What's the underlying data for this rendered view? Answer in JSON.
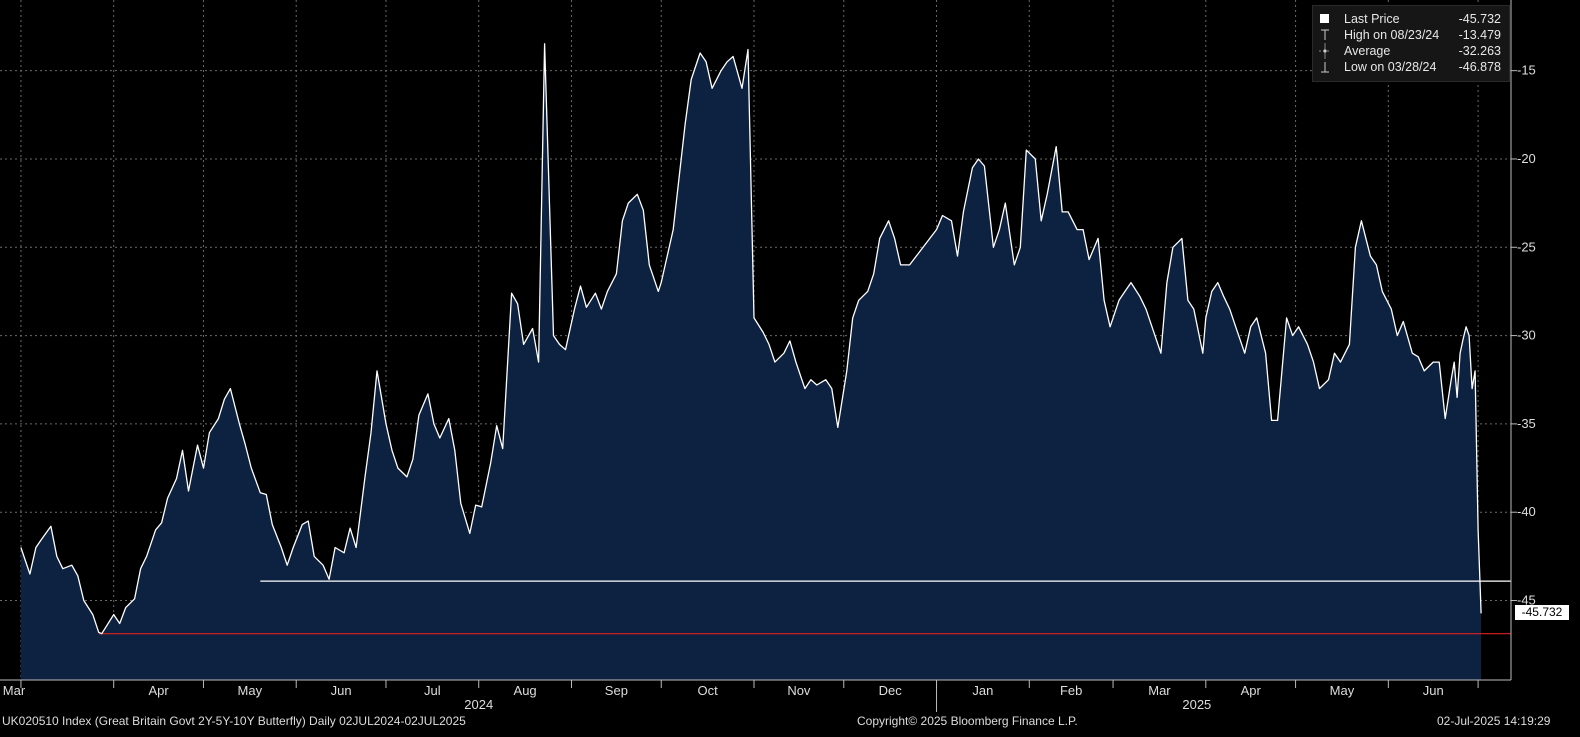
{
  "footer": {
    "left": "UK020510 Index (Great Britain Govt 2Y-5Y-10Y Butterfly)  Daily 02JUL2024-02JUL2025",
    "center": "Copyright© 2025 Bloomberg Finance L.P.",
    "right": "02-Jul-2025 14:19:29"
  },
  "legend": {
    "items": [
      {
        "icon": "square-filled-icon",
        "label": "Last Price",
        "value": "-45.732"
      },
      {
        "icon": "high-marker-icon",
        "label": "High on 08/23/24",
        "value": "-13.479"
      },
      {
        "icon": "average-line-icon",
        "label": "Average",
        "value": "-32.263"
      },
      {
        "icon": "low-marker-icon",
        "label": "Low on 03/28/24",
        "value": "-46.878"
      }
    ]
  },
  "last_value_tag": "-45.732",
  "colors": {
    "background": "#000000",
    "area_fill": "#0d2140",
    "line": "#ffffff",
    "low_line": "#e02020",
    "reference_line": "#ffffff",
    "grid": "#6a6a6a"
  },
  "chart_data": {
    "type": "area",
    "title": "",
    "xlabel": "",
    "ylabel": "",
    "ylim": [
      -49.5,
      -11
    ],
    "y_ticks": [
      -15,
      -20,
      -25,
      -30,
      -35,
      -40,
      -45
    ],
    "y_tick_labels": [
      "-15",
      "-20",
      "-25",
      "-30",
      "-35",
      "-40",
      "-45"
    ],
    "x_month_labels": [
      "Mar",
      "Apr",
      "May",
      "Jun",
      "Jul",
      "Aug",
      "Sep",
      "Oct",
      "Nov",
      "Dec",
      "Jan",
      "Feb",
      "Mar",
      "Apr",
      "May",
      "Jun"
    ],
    "x_year_labels": [
      "2024",
      "2025"
    ],
    "grid": true,
    "legend_position": "top-right",
    "reference_lines": [
      {
        "value": -43.9
      },
      {
        "value": -46.878
      }
    ],
    "series": [
      {
        "name": "Last Price",
        "points": [
          [
            "2024-03-01",
            -42.0
          ],
          [
            "2024-03-04",
            -43.5
          ],
          [
            "2024-03-06",
            -42.0
          ],
          [
            "2024-03-08",
            -41.5
          ],
          [
            "2024-03-11",
            -40.8
          ],
          [
            "2024-03-13",
            -42.5
          ],
          [
            "2024-03-15",
            -43.2
          ],
          [
            "2024-03-18",
            -43.0
          ],
          [
            "2024-03-20",
            -43.6
          ],
          [
            "2024-03-22",
            -45.0
          ],
          [
            "2024-03-25",
            -45.8
          ],
          [
            "2024-03-27",
            -46.8
          ],
          [
            "2024-03-28",
            -46.878
          ],
          [
            "2024-04-01",
            -45.8
          ],
          [
            "2024-04-03",
            -46.3
          ],
          [
            "2024-04-05",
            -45.4
          ],
          [
            "2024-04-08",
            -44.9
          ],
          [
            "2024-04-10",
            -43.2
          ],
          [
            "2024-04-12",
            -42.5
          ],
          [
            "2024-04-15",
            -41.0
          ],
          [
            "2024-04-17",
            -40.6
          ],
          [
            "2024-04-19",
            -39.2
          ],
          [
            "2024-04-22",
            -38.1
          ],
          [
            "2024-04-24",
            -36.5
          ],
          [
            "2024-04-26",
            -38.8
          ],
          [
            "2024-04-29",
            -36.2
          ],
          [
            "2024-05-01",
            -37.5
          ],
          [
            "2024-05-03",
            -35.5
          ],
          [
            "2024-05-06",
            -34.7
          ],
          [
            "2024-05-08",
            -33.6
          ],
          [
            "2024-05-10",
            -33.0
          ],
          [
            "2024-05-13",
            -35.0
          ],
          [
            "2024-05-15",
            -36.2
          ],
          [
            "2024-05-17",
            -37.5
          ],
          [
            "2024-05-20",
            -38.9
          ],
          [
            "2024-05-22",
            -39.0
          ],
          [
            "2024-05-24",
            -40.7
          ],
          [
            "2024-05-27",
            -42.0
          ],
          [
            "2024-05-29",
            -43.0
          ],
          [
            "2024-05-31",
            -42.0
          ],
          [
            "2024-06-03",
            -40.7
          ],
          [
            "2024-06-05",
            -40.5
          ],
          [
            "2024-06-07",
            -42.5
          ],
          [
            "2024-06-10",
            -43.0
          ],
          [
            "2024-06-12",
            -43.8
          ],
          [
            "2024-06-14",
            -42.0
          ],
          [
            "2024-06-17",
            -42.3
          ],
          [
            "2024-06-19",
            -40.9
          ],
          [
            "2024-06-21",
            -42.0
          ],
          [
            "2024-06-24",
            -38.0
          ],
          [
            "2024-06-26",
            -35.5
          ],
          [
            "2024-06-28",
            -32.0
          ],
          [
            "2024-07-01",
            -35.0
          ],
          [
            "2024-07-03",
            -36.5
          ],
          [
            "2024-07-05",
            -37.5
          ],
          [
            "2024-07-08",
            -38.0
          ],
          [
            "2024-07-10",
            -37.0
          ],
          [
            "2024-07-12",
            -34.5
          ],
          [
            "2024-07-15",
            -33.3
          ],
          [
            "2024-07-17",
            -35.0
          ],
          [
            "2024-07-19",
            -35.8
          ],
          [
            "2024-07-22",
            -34.7
          ],
          [
            "2024-07-24",
            -36.5
          ],
          [
            "2024-07-26",
            -39.5
          ],
          [
            "2024-07-29",
            -41.2
          ],
          [
            "2024-07-31",
            -39.6
          ],
          [
            "2024-08-02",
            -39.7
          ],
          [
            "2024-08-05",
            -37.2
          ],
          [
            "2024-08-07",
            -35.1
          ],
          [
            "2024-08-09",
            -36.4
          ],
          [
            "2024-08-12",
            -27.6
          ],
          [
            "2024-08-14",
            -28.2
          ],
          [
            "2024-08-16",
            -30.5
          ],
          [
            "2024-08-19",
            -29.6
          ],
          [
            "2024-08-21",
            -31.5
          ],
          [
            "2024-08-23",
            -13.479
          ],
          [
            "2024-08-26",
            -30.0
          ],
          [
            "2024-08-28",
            -30.5
          ],
          [
            "2024-08-30",
            -30.8
          ],
          [
            "2024-09-02",
            -28.5
          ],
          [
            "2024-09-04",
            -27.2
          ],
          [
            "2024-09-06",
            -28.4
          ],
          [
            "2024-09-09",
            -27.6
          ],
          [
            "2024-09-11",
            -28.5
          ],
          [
            "2024-09-13",
            -27.5
          ],
          [
            "2024-09-16",
            -26.5
          ],
          [
            "2024-09-18",
            -23.5
          ],
          [
            "2024-09-20",
            -22.5
          ],
          [
            "2024-09-23",
            -22.0
          ],
          [
            "2024-09-25",
            -22.9
          ],
          [
            "2024-09-27",
            -26.0
          ],
          [
            "2024-09-30",
            -27.5
          ],
          [
            "2024-10-01",
            -27.0
          ],
          [
            "2024-10-03",
            -25.5
          ],
          [
            "2024-10-05",
            -24.0
          ],
          [
            "2024-10-07",
            -21.0
          ],
          [
            "2024-10-09",
            -18.0
          ],
          [
            "2024-10-11",
            -15.5
          ],
          [
            "2024-10-14",
            -14.0
          ],
          [
            "2024-10-16",
            -14.5
          ],
          [
            "2024-10-18",
            -16.0
          ],
          [
            "2024-10-21",
            -15.0
          ],
          [
            "2024-10-23",
            -14.5
          ],
          [
            "2024-10-25",
            -14.2
          ],
          [
            "2024-10-28",
            -16.0
          ],
          [
            "2024-10-30",
            -13.8
          ],
          [
            "2024-11-01",
            -29.0
          ],
          [
            "2024-11-04",
            -29.8
          ],
          [
            "2024-11-06",
            -30.5
          ],
          [
            "2024-11-08",
            -31.5
          ],
          [
            "2024-11-11",
            -31.0
          ],
          [
            "2024-11-13",
            -30.3
          ],
          [
            "2024-11-15",
            -31.5
          ],
          [
            "2024-11-18",
            -33.0
          ],
          [
            "2024-11-20",
            -32.5
          ],
          [
            "2024-11-22",
            -32.8
          ],
          [
            "2024-11-25",
            -32.5
          ],
          [
            "2024-11-27",
            -33.0
          ],
          [
            "2024-11-29",
            -35.2
          ],
          [
            "2024-12-02",
            -32.0
          ],
          [
            "2024-12-04",
            -29.0
          ],
          [
            "2024-12-06",
            -28.0
          ],
          [
            "2024-12-09",
            -27.5
          ],
          [
            "2024-12-11",
            -26.5
          ],
          [
            "2024-12-13",
            -24.5
          ],
          [
            "2024-12-16",
            -23.5
          ],
          [
            "2024-12-18",
            -24.5
          ],
          [
            "2024-12-20",
            -26.0
          ],
          [
            "2024-12-23",
            -26.0
          ],
          [
            "2025-01-01",
            -24.0
          ],
          [
            "2025-01-03",
            -23.2
          ],
          [
            "2025-01-06",
            -23.5
          ],
          [
            "2025-01-08",
            -25.5
          ],
          [
            "2025-01-10",
            -23.0
          ],
          [
            "2025-01-13",
            -20.5
          ],
          [
            "2025-01-15",
            -20.0
          ],
          [
            "2025-01-17",
            -20.4
          ],
          [
            "2025-01-20",
            -25.0
          ],
          [
            "2025-01-22",
            -24.0
          ],
          [
            "2025-01-24",
            -22.5
          ],
          [
            "2025-01-27",
            -26.0
          ],
          [
            "2025-01-29",
            -25.0
          ],
          [
            "2025-01-31",
            -19.5
          ],
          [
            "2025-02-03",
            -20.0
          ],
          [
            "2025-02-05",
            -23.5
          ],
          [
            "2025-02-07",
            -22.0
          ],
          [
            "2025-02-10",
            -19.3
          ],
          [
            "2025-02-12",
            -23.0
          ],
          [
            "2025-02-14",
            -23.0
          ],
          [
            "2025-02-17",
            -24.0
          ],
          [
            "2025-02-19",
            -24.0
          ],
          [
            "2025-02-21",
            -25.7
          ],
          [
            "2025-02-24",
            -24.5
          ],
          [
            "2025-02-26",
            -28.0
          ],
          [
            "2025-02-28",
            -29.5
          ],
          [
            "2025-03-03",
            -28.0
          ],
          [
            "2025-03-05",
            -27.5
          ],
          [
            "2025-03-07",
            -27.0
          ],
          [
            "2025-03-10",
            -27.8
          ],
          [
            "2025-03-12",
            -28.5
          ],
          [
            "2025-03-14",
            -29.5
          ],
          [
            "2025-03-17",
            -31.0
          ],
          [
            "2025-03-19",
            -27.0
          ],
          [
            "2025-03-21",
            -25.0
          ],
          [
            "2025-03-24",
            -24.5
          ],
          [
            "2025-03-26",
            -28.0
          ],
          [
            "2025-03-28",
            -28.5
          ],
          [
            "2025-03-31",
            -31.0
          ],
          [
            "2025-04-01",
            -29.0
          ],
          [
            "2025-04-03",
            -27.5
          ],
          [
            "2025-04-05",
            -27.0
          ],
          [
            "2025-04-07",
            -27.8
          ],
          [
            "2025-04-09",
            -28.5
          ],
          [
            "2025-04-11",
            -29.5
          ],
          [
            "2025-04-14",
            -31.0
          ],
          [
            "2025-04-16",
            -29.5
          ],
          [
            "2025-04-18",
            -29.0
          ],
          [
            "2025-04-21",
            -31.0
          ],
          [
            "2025-04-23",
            -34.8
          ],
          [
            "2025-04-25",
            -34.8
          ],
          [
            "2025-04-28",
            -29.0
          ],
          [
            "2025-04-30",
            -30.0
          ],
          [
            "2025-05-02",
            -29.5
          ],
          [
            "2025-05-05",
            -30.5
          ],
          [
            "2025-05-07",
            -31.5
          ],
          [
            "2025-05-09",
            -33.0
          ],
          [
            "2025-05-12",
            -32.5
          ],
          [
            "2025-05-14",
            -31.0
          ],
          [
            "2025-05-16",
            -31.5
          ],
          [
            "2025-05-19",
            -30.5
          ],
          [
            "2025-05-21",
            -25.0
          ],
          [
            "2025-05-23",
            -23.5
          ],
          [
            "2025-05-26",
            -25.5
          ],
          [
            "2025-05-28",
            -26.0
          ],
          [
            "2025-05-30",
            -27.5
          ],
          [
            "2025-06-02",
            -28.5
          ],
          [
            "2025-06-04",
            -30.0
          ],
          [
            "2025-06-06",
            -29.2
          ],
          [
            "2025-06-09",
            -31.0
          ],
          [
            "2025-06-11",
            -31.2
          ],
          [
            "2025-06-13",
            -32.0
          ],
          [
            "2025-06-16",
            -31.5
          ],
          [
            "2025-06-18",
            -31.5
          ],
          [
            "2025-06-20",
            -34.7
          ],
          [
            "2025-06-22",
            -32.5
          ],
          [
            "2025-06-23",
            -31.5
          ],
          [
            "2025-06-24",
            -33.5
          ],
          [
            "2025-06-25",
            -31.0
          ],
          [
            "2025-06-26",
            -30.2
          ],
          [
            "2025-06-27",
            -29.5
          ],
          [
            "2025-06-28",
            -30.0
          ],
          [
            "2025-06-29",
            -33.0
          ],
          [
            "2025-06-30",
            -32.0
          ],
          [
            "2025-07-01",
            -41.0
          ],
          [
            "2025-07-02",
            -45.732
          ]
        ]
      }
    ]
  }
}
